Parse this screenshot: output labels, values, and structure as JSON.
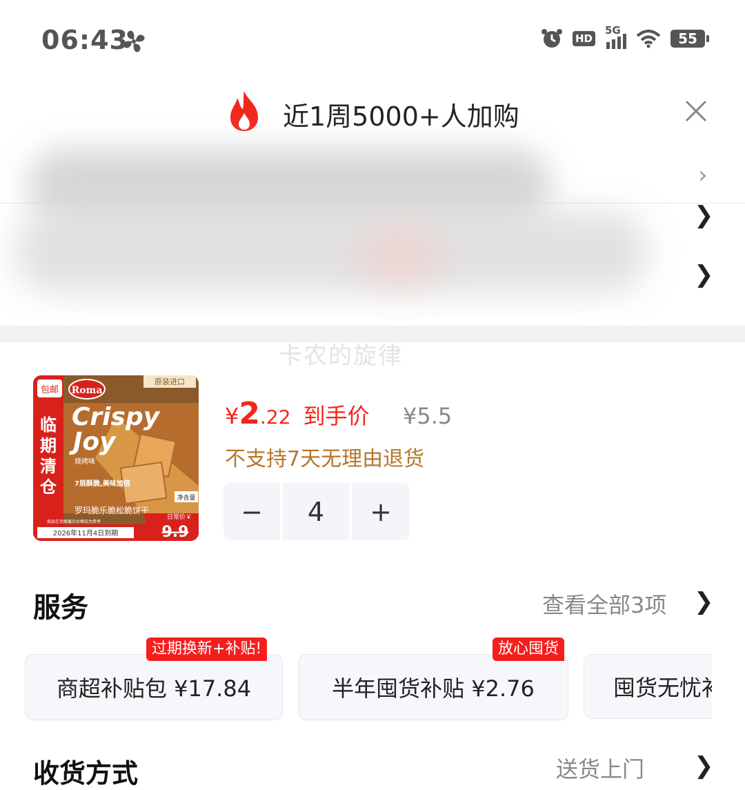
{
  "status_bar": {
    "time": "06:43",
    "network": "5G",
    "hd": "HD",
    "battery": "55"
  },
  "banner": {
    "text": "近1周5000+人加购"
  },
  "watermark": "卡农的旋律",
  "product": {
    "image": {
      "badge_free_ship": "包邮",
      "brand": "Roma",
      "imported": "原装进口",
      "name_line1": "Crispy",
      "name_line2": "Joy",
      "flavor": "烧烤味",
      "layers": "7层酥脆,美味加倍",
      "clearance": "临期清仓",
      "chinese_name": "罗玛脆乐脆松脆饼干",
      "net": "净含量",
      "daily_price_label": "日常价￥",
      "daily_price": "9.9",
      "expiry": "2026年11月4日到期",
      "note": "商品在页面展示价格仅为参考"
    },
    "price_symbol": "¥",
    "price_int": "2",
    "price_dec": ".22",
    "price_label": "到手价",
    "original_price": "¥5.5",
    "return_policy": "不支持7天无理由退货",
    "stepper": {
      "minus": "−",
      "quantity": "4",
      "plus": "+"
    }
  },
  "services": {
    "title": "服务",
    "view_all": "查看全部3项",
    "items": [
      {
        "label": "商超补贴包  ¥17.84",
        "tag": "过期换新+补贴!"
      },
      {
        "label": "半年囤货补贴  ¥2.76",
        "tag": "放心囤货"
      },
      {
        "label": "囤货无忧补贴",
        "tag": ""
      }
    ]
  },
  "delivery": {
    "title": "收货方式",
    "value": "送货上门"
  }
}
